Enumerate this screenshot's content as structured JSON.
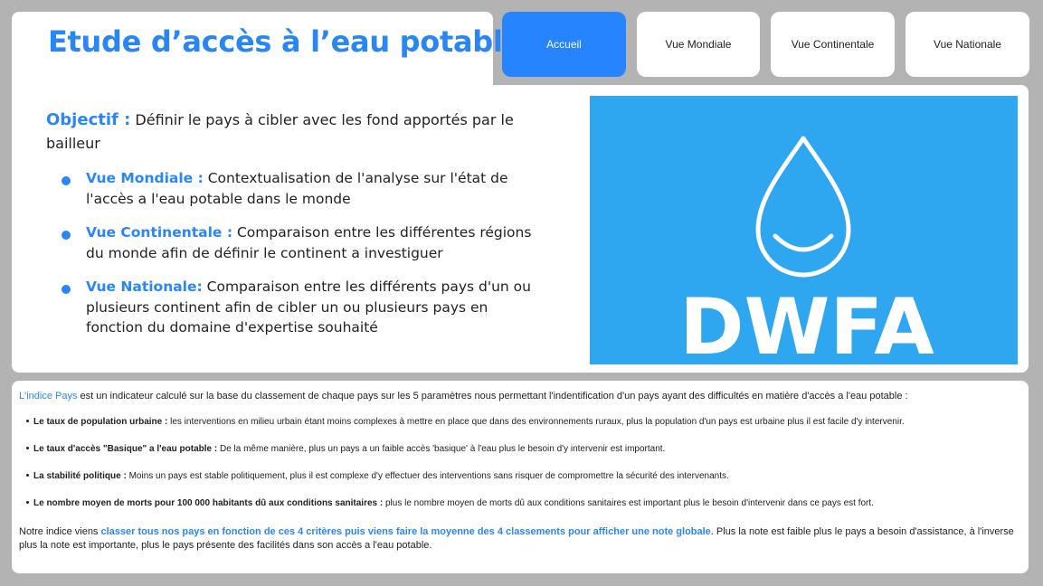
{
  "header": {
    "title": "Etude d’accès à l’eau potable"
  },
  "nav": {
    "items": [
      {
        "label": "Accueil",
        "active": true
      },
      {
        "label": "Vue Mondiale",
        "active": false
      },
      {
        "label": "Vue Continentale",
        "active": false
      },
      {
        "label": "Vue Nationale",
        "active": false
      }
    ]
  },
  "objective": {
    "keyword": "Objectif :",
    "text": " Définir le pays à cibler avec les fond apportés par le bailleur"
  },
  "views": [
    {
      "keyword": "Vue Mondiale :",
      "text": " Contextualisation de l'analyse sur l'état de l'accès a l'eau potable dans le monde"
    },
    {
      "keyword": "Vue Continentale :",
      "text": " Comparaison entre les différentes régions du monde afin de définir le continent a investiguer"
    },
    {
      "keyword": "Vue Nationale:",
      "text": " Comparaison entre les différents pays d'un ou plusieurs continent afin de cibler un ou plusieurs pays en fonction du domaine d'expertise souhaité"
    }
  ],
  "logo": {
    "text": "DWFA",
    "background": "#2ea6f0"
  },
  "indice": {
    "keyword": "L'indice Pays",
    "text": " est un indicateur calculé sur la base du classement de chaque pays sur les 5 paramètres nous permettant l'indentification d'un pays ayant des difficultés en matière d'accès a l'eau potable :",
    "criteria": [
      {
        "title": "Le taux de population urbaine :",
        "text": " les interventions en milieu urbain étant moins complexes à mettre en place que dans des environnements ruraux, plus la population d'un pays est urbaine plus il est facile d'y intervenir."
      },
      {
        "title": "Le taux d'accès \"Basique\" a l'eau potable :",
        "text": " De la même manière, plus un pays a un faible accès 'basique' à l'eau plus le besoin d'y intervenir est important."
      },
      {
        "title": "La stabilité politique :",
        "text": " Moins un pays est stable politiquement, plus il est complexe d'y effectuer des interventions sans risquer de compromettre la sécurité des intervenants."
      },
      {
        "title": "Le nombre moyen de morts pour 100 000 habitants dû aux conditions sanitaires :",
        "text": " plus le nombre moyen de morts dû aux conditions sanitaires est important plus le besoin d'intervenir dans ce pays est fort."
      }
    ],
    "conclusion": {
      "prefix": "Notre indice viens ",
      "keyword": "classer tous nos pays en fonction de ces 4 critères puis viens faire la moyenne des 4 classements pour afficher une note globale",
      "suffix": ". Plus la note est faible plus le pays a besoin d'assistance, à l'inverse plus la note est importante, plus le pays présente des facilités dans son accès a l'eau potable."
    }
  },
  "colors": {
    "accent": "#2a86f5",
    "active_nav": "#2684ff",
    "page_bg": "#b3b3b3"
  }
}
